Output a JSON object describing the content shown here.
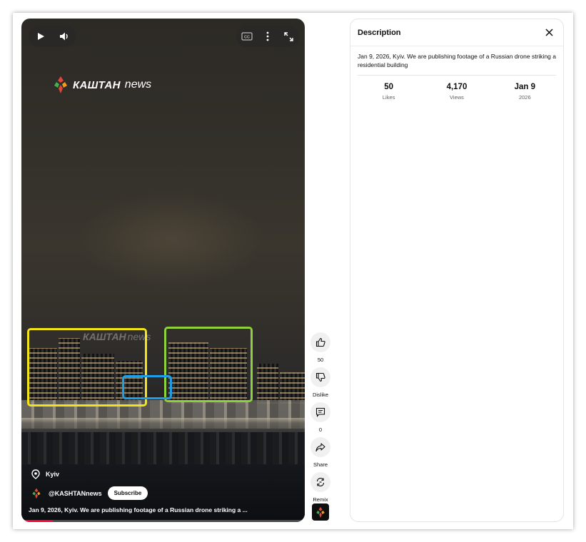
{
  "video": {
    "logo_brand": "КАШТАН",
    "logo_suffix": "news",
    "watermark_brand": "КАШТАН",
    "watermark_suffix": "news",
    "location": "Kyiv",
    "channel": "@KASHTANnews",
    "subscribe_label": "Subscribe",
    "caption": "Jan 9, 2026, Kyiv. We are publishing footage of a Russian drone striking a ...",
    "progress": 0.11
  },
  "controls": {
    "play_icon": "play-icon",
    "volume_icon": "volume-icon",
    "cc_icon": "closed-captions-icon",
    "more_icon": "more-vert-icon",
    "fullscreen_icon": "fullscreen-icon"
  },
  "actions": {
    "like_count": "50",
    "dislike_label": "Dislike",
    "comment_count": "0",
    "share_label": "Share",
    "remix_label": "Remix"
  },
  "description_panel": {
    "title": "Description",
    "text": "Jan 9, 2026, Kyiv. We are publishing footage of a Russian drone striking a residential building",
    "stats": [
      {
        "value": "50",
        "label": "Likes"
      },
      {
        "value": "4,170",
        "label": "Views"
      },
      {
        "value": "Jan 9",
        "label": "2026"
      }
    ]
  },
  "colors": {
    "box_yellow": "#f2e31a",
    "box_green": "#8fd13a",
    "box_blue": "#1e9ee6",
    "progress_red": "#ff0033",
    "logo_red": "#e2453a",
    "logo_green": "#3fb34f",
    "logo_orange": "#f29c1f"
  }
}
